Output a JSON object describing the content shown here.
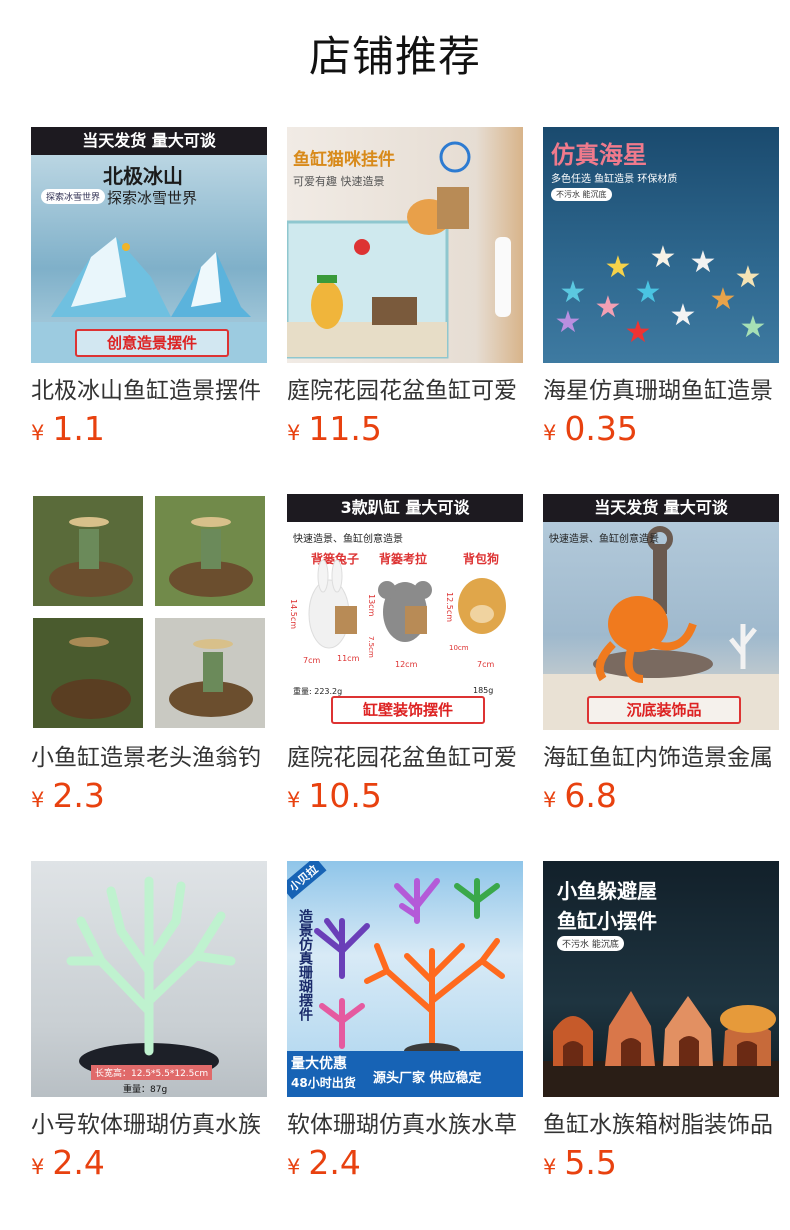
{
  "page": {
    "title": "店铺推荐"
  },
  "currency_symbol": "¥",
  "products": [
    {
      "name": "北极冰山鱼缸造景摆件",
      "price": "1.1",
      "image": {
        "banner": "当天发货 量大可谈",
        "heading": "北极冰山",
        "subheading": "探索冰雪世界",
        "badge": "探索冰雪世界",
        "footer": "创意造景摆件"
      }
    },
    {
      "name": "庭院花园花盆鱼缸可爱",
      "price": "11.5",
      "image": {
        "heading": "鱼缸猫咪挂件",
        "subheading": "可爱有趣 快速造景"
      }
    },
    {
      "name": "海星仿真珊瑚鱼缸造景",
      "price": "0.35",
      "image": {
        "heading": "仿真海星",
        "subheading": "多色任选 鱼缸造景 环保材质",
        "badge": "不污水 能沉底"
      }
    },
    {
      "name": "小鱼缸造景老头渔翁钓",
      "price": "2.3",
      "image": {}
    },
    {
      "name": "庭院花园花盆鱼缸可爱",
      "price": "10.5",
      "image": {
        "banner": "3款趴缸 量大可谈",
        "subheading": "快速造景、鱼缸创意造景",
        "labels": [
          "背篓兔子",
          "背篓考拉",
          "背包狗"
        ],
        "dims": [
          "14.5cm",
          "7cm",
          "11cm",
          "13cm",
          "7.5cm",
          "12cm",
          "12.5cm",
          "10cm",
          "7cm"
        ],
        "weights": [
          "重量: 223.2g",
          "185g"
        ],
        "footer": "缸壁装饰摆件"
      }
    },
    {
      "name": "海缸鱼缸内饰造景金属",
      "price": "6.8",
      "image": {
        "banner": "当天发货 量大可谈",
        "subheading": "快速造景、鱼缸创意造景",
        "footer": "沉底装饰品"
      }
    },
    {
      "name": "小号软体珊瑚仿真水族",
      "price": "2.4",
      "image": {
        "size_label": "长宽高：12.5*5.5*12.5cm",
        "weight_label": "重量：87g"
      }
    },
    {
      "name": "软体珊瑚仿真水族水草",
      "price": "2.4",
      "image": {
        "corner": "小贝拉",
        "vertical": "造景仿真珊瑚摆件",
        "promo1": "量大优惠",
        "promo2": "48小时出货",
        "promo3": "源头厂家 供应稳定"
      }
    },
    {
      "name": "鱼缸水族箱树脂装饰品",
      "price": "5.5",
      "image": {
        "heading": "小鱼躲避屋",
        "heading2": "鱼缸小摆件",
        "badge": "不污水 能沉底"
      }
    }
  ],
  "colors": {
    "price": "#e8410f",
    "title": "#111111",
    "name": "#333333"
  }
}
